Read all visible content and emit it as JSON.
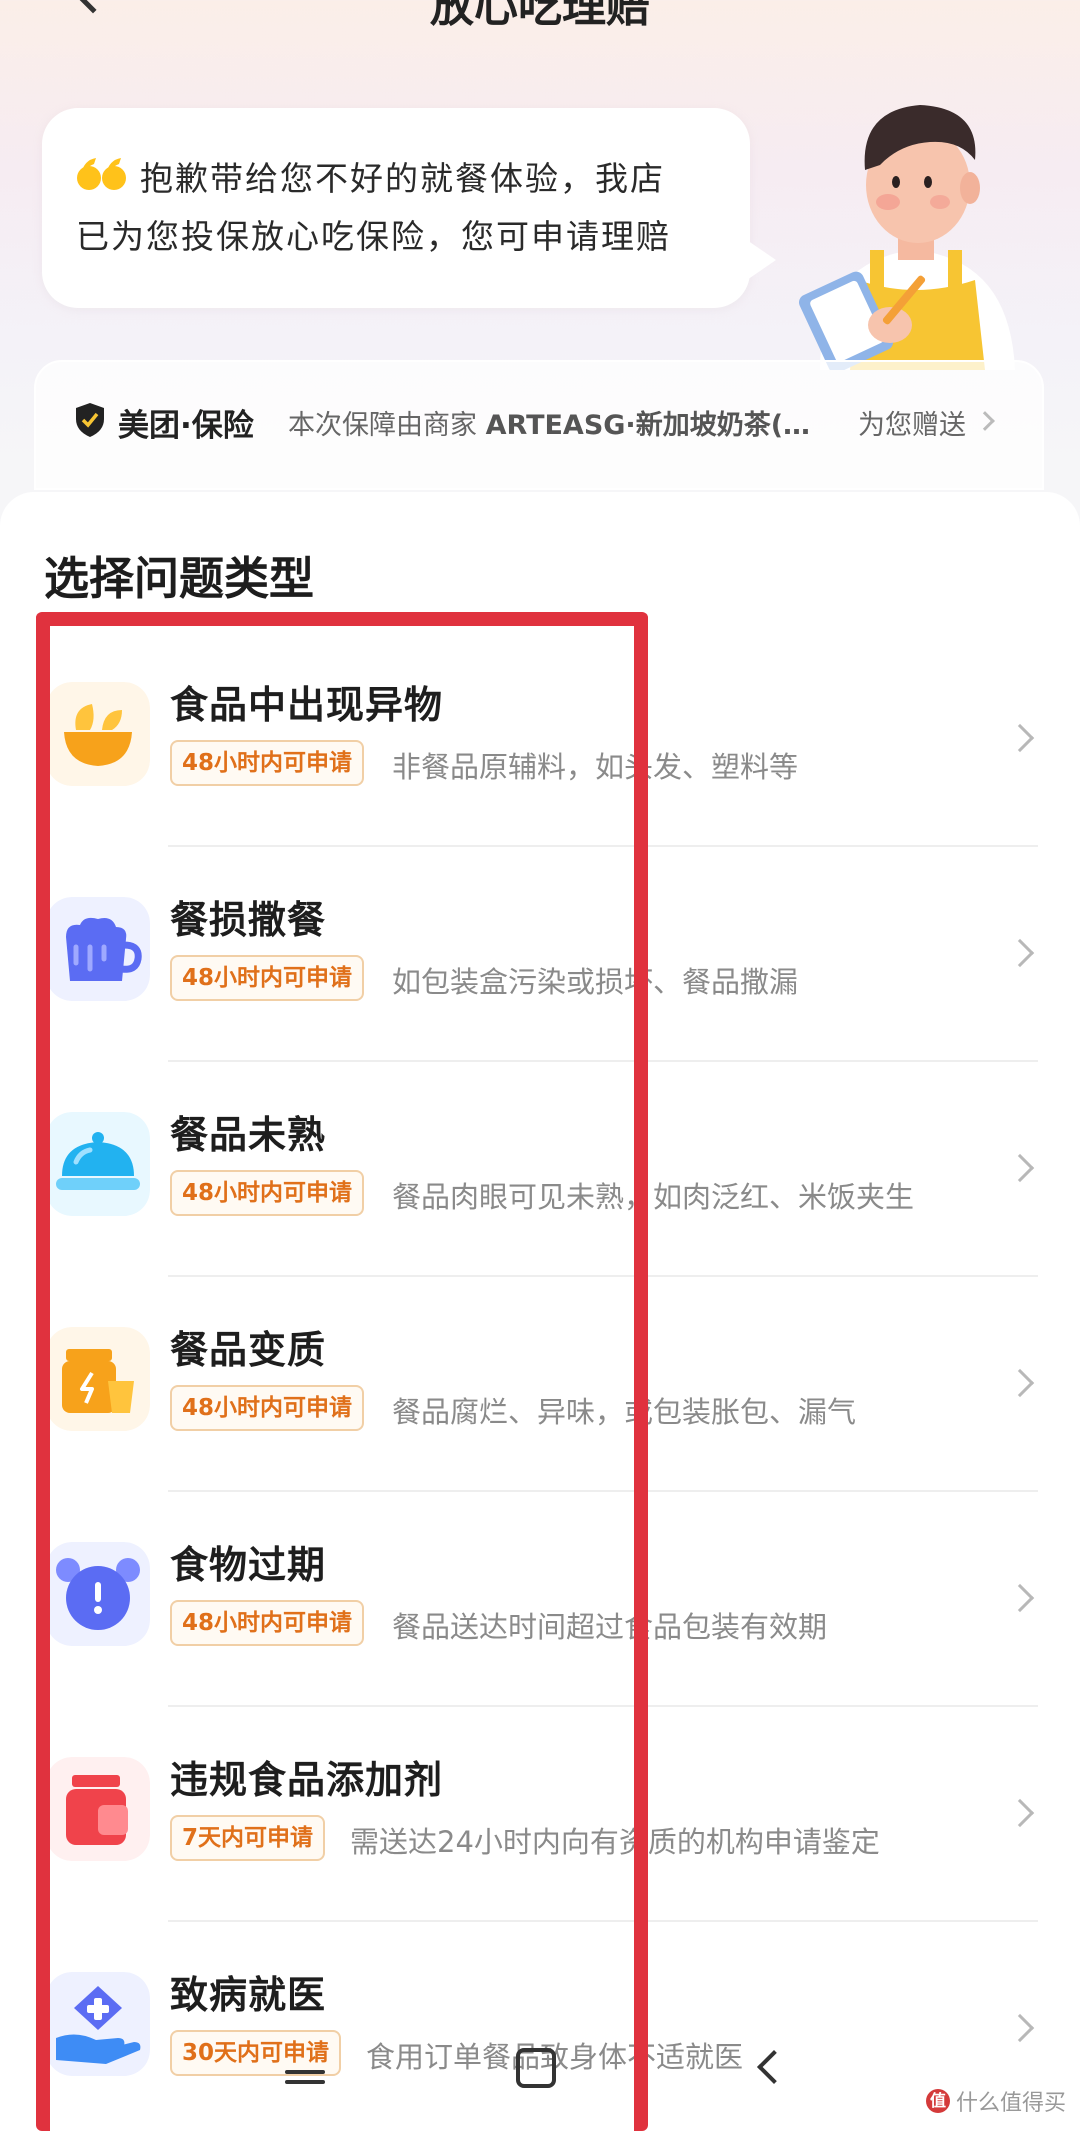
{
  "header": {
    "title": "放心吃理赔"
  },
  "bubble": {
    "line1": "抱歉带给您不好的就餐体验，我店",
    "line2": "已为您投保放心吃保险，您可申请理赔"
  },
  "insurance": {
    "brand": "美团·保险",
    "text_prefix": "本次保障由商家",
    "merchant": "ARTEASG·新加坡奶茶(…",
    "gift": "为您赠送"
  },
  "section_title": "选择问题类型",
  "issues": [
    {
      "name": "食品中出现异物",
      "badge": "48小时内可申请",
      "desc": "非餐品原辅料，如头发、塑料等",
      "icon": "bowl-icon"
    },
    {
      "name": "餐损撒餐",
      "badge": "48小时内可申请",
      "desc": "如包装盒污染或损坏、餐品撒漏",
      "icon": "spilled-cup-icon"
    },
    {
      "name": "餐品未熟",
      "badge": "48小时内可申请",
      "desc": "餐品肉眼可见未熟，如肉泛红、米饭夹生",
      "icon": "cloche-icon"
    },
    {
      "name": "餐品变质",
      "badge": "48小时内可申请",
      "desc": "餐品腐烂、异味，或包装胀包、漏气",
      "icon": "spoiled-jar-icon"
    },
    {
      "name": "食物过期",
      "badge": "48小时内可申请",
      "desc": "餐品送达时间超过食品包装有效期",
      "icon": "alarm-clock-icon"
    },
    {
      "name": "违规食品添加剂",
      "badge": "7天内可申请",
      "desc": "需送达24小时内向有资质的机构申请鉴定",
      "icon": "bottle-icon"
    },
    {
      "name": "致病就医",
      "badge": "30天内可申请",
      "desc": "食用订单餐品致身体不适就医",
      "icon": "medical-hand-icon"
    }
  ],
  "watermark": {
    "logo": "值",
    "text": "什么值得买"
  },
  "colors": {
    "accent_orange": "#e0701a",
    "badge_border": "#f1cfa6",
    "highlight_red": "#e0323e"
  }
}
